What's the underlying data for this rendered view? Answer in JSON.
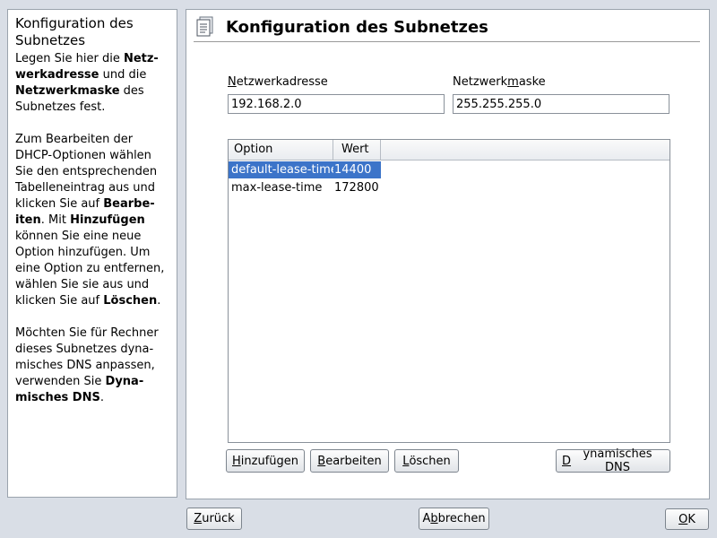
{
  "help": {
    "title": "Konfiguration des Subnetzes",
    "p1": [
      {
        "t": "Legen Sie hier die ",
        "b": false
      },
      {
        "t": "Netz-werkadresse",
        "b": true
      },
      {
        "t": " und die ",
        "b": false
      },
      {
        "t": "Netzwerkmaske",
        "b": true
      },
      {
        "t": " des Subnetzes fest.",
        "b": false
      }
    ],
    "p2": [
      {
        "t": "Zum Bearbeiten der DHCP-Optionen wählen Sie den entsprechenden Tabelleneintrag aus und klicken Sie auf ",
        "b": false
      },
      {
        "t": "Bearbe-iten",
        "b": true
      },
      {
        "t": ". Mit ",
        "b": false
      },
      {
        "t": "Hinzufügen",
        "b": true
      },
      {
        "t": " können Sie eine neue Option hinzufügen. Um eine Option zu entfernen, wählen Sie sie aus und klicken Sie auf ",
        "b": false
      },
      {
        "t": "Löschen",
        "b": true
      },
      {
        "t": ".",
        "b": false
      }
    ],
    "p3": [
      {
        "t": "Möchten Sie für Rechner dieses Subnetzes dyna-misches DNS anpassen, verwenden Sie ",
        "b": false
      },
      {
        "t": "Dyna-misches DNS",
        "b": true
      },
      {
        "t": ".",
        "b": false
      }
    ]
  },
  "main": {
    "title": "Konfiguration des Subnetzes",
    "icon": "config-document-icon",
    "network_address": {
      "label_pre": "",
      "label_u": "N",
      "label_post": "etzwerkadresse",
      "value": "192.168.2.0"
    },
    "netmask": {
      "label_pre": "Netzwerk",
      "label_u": "m",
      "label_post": "aske",
      "value": "255.255.255.0"
    },
    "table": {
      "columns": [
        "Option",
        "Wert"
      ],
      "rows": [
        {
          "option": "default-lease-time",
          "value": "14400",
          "selected": true
        },
        {
          "option": "max-lease-time",
          "value": "172800",
          "selected": false
        }
      ]
    },
    "buttons": {
      "add": {
        "u": "H",
        "rest": "inzufügen"
      },
      "edit": {
        "u": "B",
        "rest": "earbeiten"
      },
      "delete": {
        "u": "L",
        "rest": "öschen"
      },
      "dns": {
        "u": "D",
        "rest": "ynamisches DNS"
      }
    }
  },
  "footer": {
    "back": {
      "u": "Z",
      "rest": "urück"
    },
    "cancel": {
      "pre": "A",
      "u": "b",
      "rest": "brechen"
    },
    "ok": {
      "u": "O",
      "rest": "K"
    }
  },
  "colors": {
    "selection": "#3c74c9",
    "background": "#d9dee6"
  }
}
